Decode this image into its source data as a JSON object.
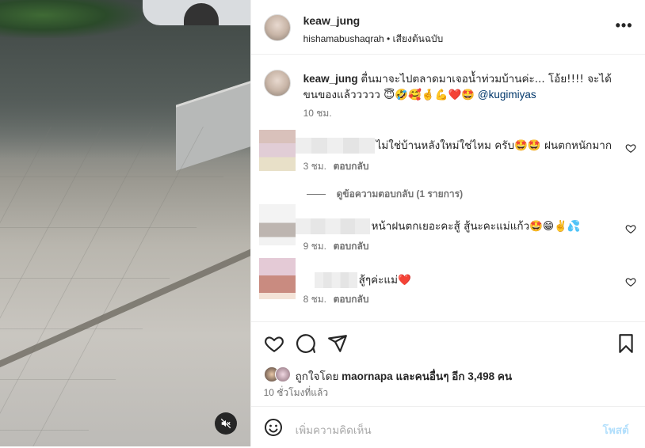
{
  "media": {
    "mute_icon": "speaker-muted-icon"
  },
  "header": {
    "username": "keaw_jung",
    "subline": "hishamabushaqrah • เสียงต้นฉบับ",
    "more_icon": "more-options-icon"
  },
  "caption": {
    "username": "keaw_jung",
    "text": "ตื่นมาจะไปตลาดมาเจอน้ำท่วมบ้านค่ะ... โอ้ย!!!! จะได้ขนของแล้ววววว 😇🤣🥰🤞💪❤️🤩",
    "mention": "@kugimiyas",
    "time": "10 ชม."
  },
  "comments": [
    {
      "text": "ไม่ใช่บ้านหลังใหม่ใช่ไหม ครับ🤩🤩 ฝนตกหนักมาก",
      "time": "3 ชม.",
      "reply": "ตอบกลับ"
    },
    {
      "text": "หน้าฝนตกเยอะคะสู้ สู้นะคะแม่แก้ว🤩😁✌️💦",
      "time": "9 ชม.",
      "reply": "ตอบกลับ"
    },
    {
      "text": "สู้ๆค่ะแม่❤️",
      "time": "8 ชม.",
      "reply": "ตอบกลับ"
    }
  ],
  "view_replies": "ดูข้อความตอบกลับ (1 รายการ)",
  "likes": {
    "prefix": "ถูกใจโดย",
    "user": "maornapa",
    "and_others": "และคนอื่นๆ อีก 3,498 คน"
  },
  "posted_ago": "10 ชั่วโมงที่แล้ว",
  "add_comment": {
    "placeholder": "เพิ่มความคิดเห็น",
    "post_label": "โพสต์"
  },
  "colors": {
    "link": "#00376b",
    "muted": "#737373",
    "post_disabled": "#b2dffc"
  }
}
